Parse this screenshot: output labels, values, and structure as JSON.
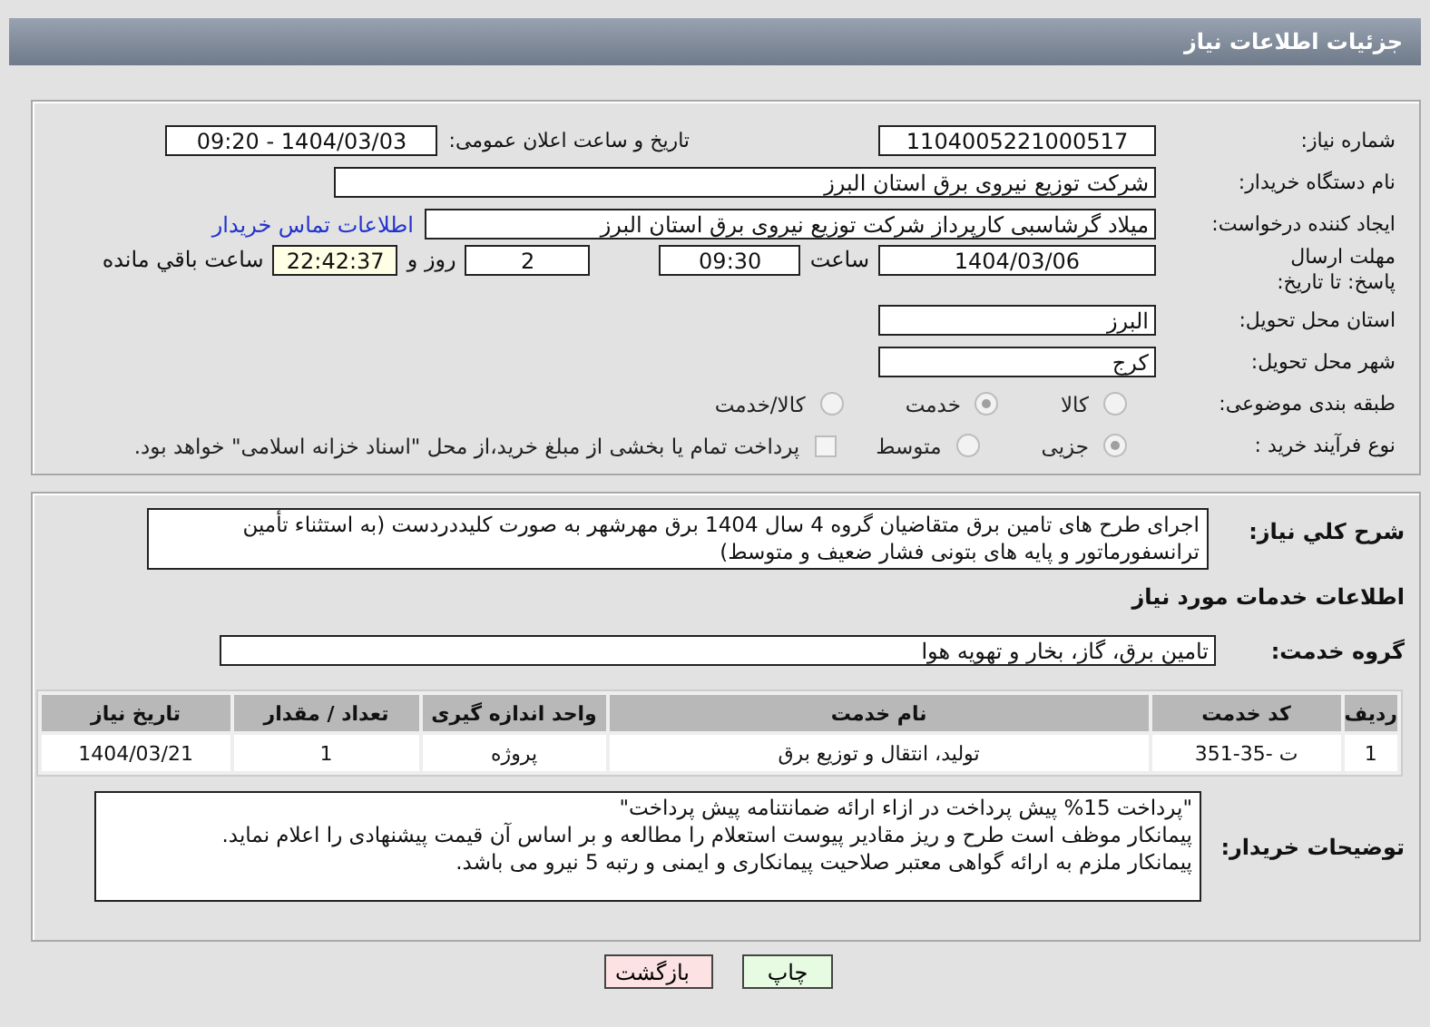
{
  "header": {
    "title": "جزئیات اطلاعات نیاز"
  },
  "need_number": {
    "label": "شماره نیاز:",
    "value": "1104005221000517"
  },
  "announce": {
    "label": "تاریخ و ساعت اعلان عمومی:",
    "value": "1404/03/03 - 09:20"
  },
  "buyer": {
    "label": "نام دستگاه خریدار:",
    "value": "شرکت توزیع نیروی برق استان البرز"
  },
  "creator": {
    "label": "ایجاد کننده درخواست:",
    "value": "میلاد گرشاسبی کارپرداز شرکت توزیع نیروی برق استان البرز",
    "link": "اطلاعات تماس خریدار"
  },
  "deadline": {
    "label": "مهلت ارسال پاسخ: تا تاریخ:",
    "date": "1404/03/06",
    "time_label": "ساعت",
    "time": "09:30",
    "days": "2",
    "days_label": "روز و",
    "remaining": "22:42:37",
    "remaining_label": "ساعت باقي مانده"
  },
  "province": {
    "label": "استان محل تحویل:",
    "value": "البرز"
  },
  "city": {
    "label": "شهر محل تحویل:",
    "value": "کرج"
  },
  "category": {
    "label": "طبقه بندی موضوعی:",
    "options": [
      {
        "label": "کالا",
        "selected": false
      },
      {
        "label": "خدمت",
        "selected": true
      },
      {
        "label": "کالا/خدمت",
        "selected": false
      }
    ]
  },
  "process": {
    "label": "نوع فرآیند خرید :",
    "options": [
      {
        "label": "جزیی",
        "selected": true
      },
      {
        "label": "متوسط",
        "selected": false
      }
    ],
    "treasury": {
      "label": "پرداخت تمام یا بخشی از مبلغ خرید،از محل \"اسناد خزانه اسلامی\" خواهد بود.",
      "checked": false
    }
  },
  "description": {
    "label": "شرح کلي نیاز:",
    "value": "اجرای طرح های تامین برق متقاضیان گروه 4  سال 1404 برق مهرشهر به صورت کلیددردست (به استثناء تأمین ترانسفورماتور و پایه های بتونی فشار ضعیف و متوسط)"
  },
  "services_heading": "اطلاعات خدمات مورد نیاز",
  "service_group": {
    "label": "گروه خدمت:",
    "value": "تامین برق، گاز، بخار و تهویه هوا"
  },
  "table": {
    "columns": [
      "ردیف",
      "کد خدمت",
      "نام خدمت",
      "واحد اندازه گیری",
      "تعداد / مقدار",
      "تاریخ نیاز"
    ],
    "rows": [
      [
        "1",
        "ت -35-351",
        "تولید، انتقال و توزیع برق",
        "پروژه",
        "1",
        "1404/03/21"
      ]
    ]
  },
  "buyer_notes": {
    "label": "توضیحات خریدار:",
    "lines": [
      "\"پرداخت 15% پیش پرداخت در ازاء ارائه ضمانتنامه پیش پرداخت\"",
      "پیمانکار موظف است طرح و ریز مقادیر پیوست استعلام را مطالعه و بر اساس آن قیمت پیشنهادی را اعلام نماید.",
      "پیمانکار ملزم به ارائه گواهی معتبر صلاحیت پیمانکاری و ایمنی و رتبه 5 نیرو می باشد."
    ]
  },
  "buttons": [
    {
      "label": "چاپ",
      "kind": "print"
    },
    {
      "label": "بازگشت",
      "kind": "back"
    }
  ]
}
